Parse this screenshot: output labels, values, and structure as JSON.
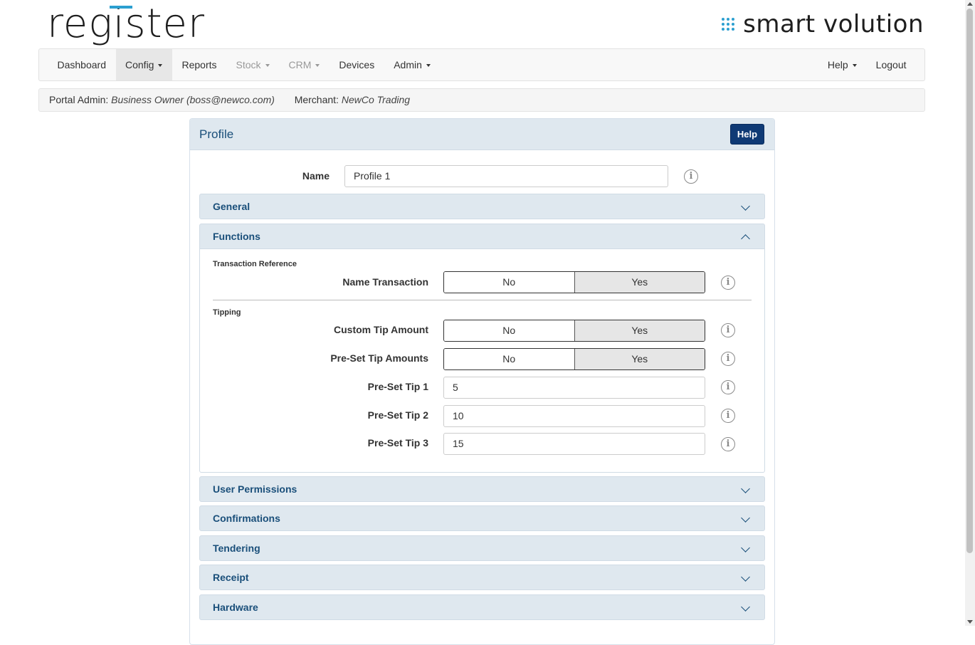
{
  "brand": {
    "left_logo": "register",
    "right_logo": "smart volution"
  },
  "nav": {
    "left": [
      {
        "label": "Dashboard"
      },
      {
        "label": "Config"
      },
      {
        "label": "Reports"
      },
      {
        "label": "Stock"
      },
      {
        "label": "CRM"
      },
      {
        "label": "Devices"
      },
      {
        "label": "Admin"
      }
    ],
    "right": [
      {
        "label": "Help"
      },
      {
        "label": "Logout"
      }
    ]
  },
  "info": {
    "portal_admin_label": "Portal Admin:",
    "portal_admin_value": "Business Owner (boss@newco.com)",
    "merchant_label": "Merchant:",
    "merchant_value": "NewCo Trading"
  },
  "panel": {
    "title": "Profile",
    "help_label": "Help",
    "name_label": "Name",
    "name_value": "Profile 1"
  },
  "sections": {
    "general": "General",
    "functions": "Functions",
    "user_permissions": "User Permissions",
    "confirmations": "Confirmations",
    "tendering": "Tendering",
    "receipt": "Receipt",
    "hardware": "Hardware"
  },
  "functions": {
    "transaction_reference": "Transaction Reference",
    "name_transaction": {
      "label": "Name Transaction",
      "no": "No",
      "yes": "Yes",
      "selected": "Yes"
    },
    "tipping": "Tipping",
    "custom_tip_amount": {
      "label": "Custom Tip Amount",
      "no": "No",
      "yes": "Yes",
      "selected": "Yes"
    },
    "preset_tip_amounts": {
      "label": "Pre-Set Tip Amounts",
      "no": "No",
      "yes": "Yes",
      "selected": "Yes"
    },
    "preset_tip_1": {
      "label": "Pre-Set Tip 1",
      "value": "5"
    },
    "preset_tip_2": {
      "label": "Pre-Set Tip 2",
      "value": "10"
    },
    "preset_tip_3": {
      "label": "Pre-Set Tip 3",
      "value": "15"
    }
  },
  "icons": {
    "info": "info-circle-icon",
    "chevron_down": "chevron-down-icon",
    "chevron_up": "chevron-up-icon",
    "caret": "caret-down-icon"
  },
  "colors": {
    "accent": "#2c9fd0",
    "header_bg": "#dfe8ef",
    "title_blue": "#1a4f7a",
    "help_button": "#0f3a75"
  }
}
